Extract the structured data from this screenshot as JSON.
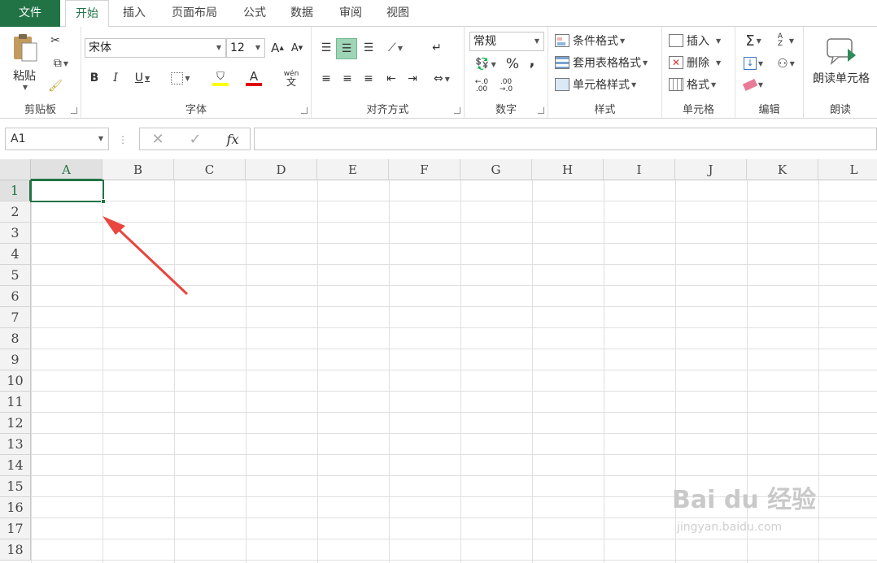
{
  "tabs": {
    "file": "文件",
    "home": "开始",
    "insert": "插入",
    "layout": "页面布局",
    "formulas": "公式",
    "data": "数据",
    "review": "审阅",
    "view": "视图"
  },
  "ribbon": {
    "clipboard": {
      "paste": "粘贴",
      "label": "剪贴板"
    },
    "font": {
      "name": "宋体",
      "size": "12",
      "bold": "B",
      "italic": "I",
      "underline": "U",
      "label": "字体",
      "grow": "A",
      "shrink": "A",
      "color_a": "A",
      "phonetic_top": "wén",
      "phonetic_bottom": "文"
    },
    "alignment": {
      "label": "对齐方式"
    },
    "number": {
      "format": "常规",
      "percent": "%",
      "comma": ",",
      "inc": "←.0 .00",
      "dec": ".00 →.0",
      "label": "数字"
    },
    "styles": {
      "conditional": "条件格式",
      "table": "套用表格格式",
      "cell": "单元格样式",
      "label": "样式"
    },
    "cells": {
      "insert": "插入",
      "delete": "删除",
      "format": "格式",
      "label": "单元格"
    },
    "editing": {
      "label": "编辑",
      "sum": "Σ",
      "sort": "A Z"
    },
    "read": {
      "button": "朗读单元格",
      "label": "朗读"
    }
  },
  "formula_bar": {
    "name_box": "A1",
    "fx": "fx",
    "value": ""
  },
  "grid": {
    "columns": [
      "A",
      "B",
      "C",
      "D",
      "E",
      "F",
      "G",
      "H",
      "I",
      "J",
      "K",
      "L"
    ],
    "rows": [
      "1",
      "2",
      "3",
      "4",
      "5",
      "6",
      "7",
      "8",
      "9",
      "10",
      "11",
      "12",
      "13",
      "14",
      "15",
      "16",
      "17",
      "18"
    ],
    "selected": "A1"
  },
  "colors": {
    "accent": "#217346",
    "arrow": "#e8463f"
  },
  "watermark": {
    "brand": "Bai du 经验",
    "url": "jingyan.baidu.com"
  }
}
